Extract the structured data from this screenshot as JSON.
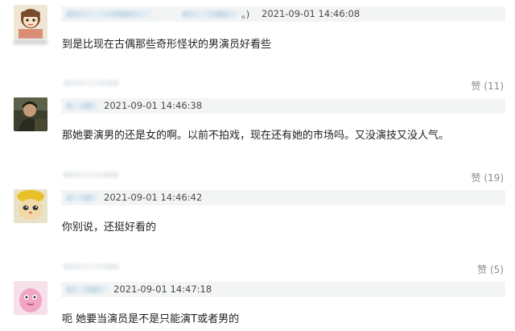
{
  "comments": [
    {
      "time": "2021-09-01 14:46:08",
      "text": "到是比现在古偶那些奇形怪状的男演员好看些",
      "likes": "赞 (11)",
      "name_suffix": "。)"
    },
    {
      "time": "2021-09-01 14:46:38",
      "text": "那她要演男的还是女的啊。以前不拍戏，现在还有她的市场吗。又没演技又没人气。",
      "likes": "赞 (19)"
    },
    {
      "time": "2021-09-01 14:46:42",
      "text": "你别说，还挺好看的",
      "likes": "赞 (5)"
    },
    {
      "time": "2021-09-01 14:47:18",
      "text": "呃 她要当演员是不是只能演T或者男的"
    }
  ],
  "avatars": [
    "cartoon-girl-avatar",
    "person-photo-avatar",
    "yellow-cat-avatar",
    "pink-cartoon-avatar"
  ],
  "colors": {
    "meta_bar": "#f2f5f4",
    "like_text": "#8c8c8c",
    "blur_name": "#c6dbea"
  }
}
